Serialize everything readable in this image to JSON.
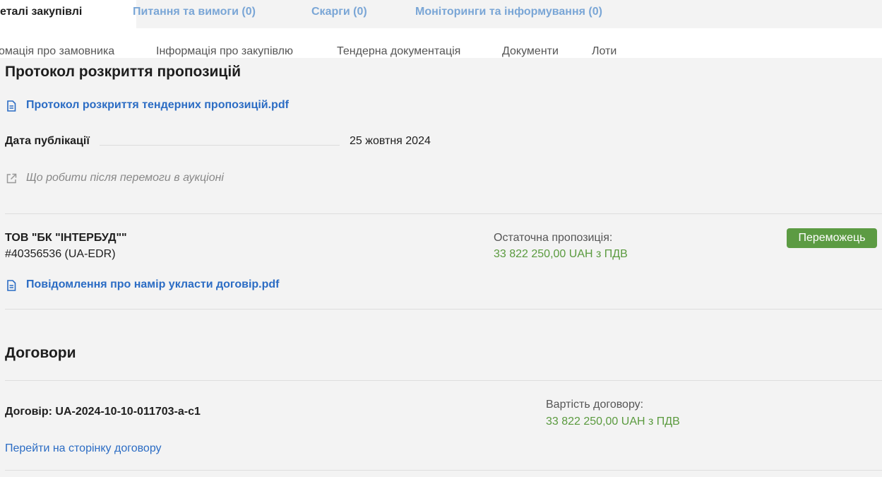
{
  "tabs": [
    {
      "label": "еталі закупівлі"
    },
    {
      "label": "Питання та вимоги (0)"
    },
    {
      "label": "Скарги (0)"
    },
    {
      "label": "Моніторинги та інформування (0)"
    }
  ],
  "subnav": [
    {
      "label": "омація про замовника"
    },
    {
      "label": "Інформація про закупівлю"
    },
    {
      "label": "Тендерна документація"
    },
    {
      "label": "Документи"
    },
    {
      "label": "Лоти"
    }
  ],
  "protocol": {
    "title": "Протокол розкриття пропозицій",
    "file_link": "Протокол розкриття тендерних пропозицій.pdf",
    "date_label": "Дата публікації",
    "date_value": "25 жовтня 2024",
    "help_link": "Що робити після перемоги в аукціоні"
  },
  "winner": {
    "name": "ТОВ \"БК \"ІНТЕРБУД\"\"",
    "edr": "#40356536 (UA-EDR)",
    "offer_label": "Остаточна пропозиція:",
    "offer_value": "33 822 250,00 UAH з ПДВ",
    "badge": "Переможець",
    "notice_link": "Повідомлення про намір укласти договір.pdf"
  },
  "contracts": {
    "title": "Договори",
    "contract_label": "Договір: UA-2024-10-10-011703-a-c1",
    "value_label": "Вартість договору:",
    "value": "33 822 250,00 UAH з ПДВ",
    "link": "Перейти на сторінку договору"
  },
  "colors": {
    "link": "#2b6cc4",
    "money_green": "#5a9a3e",
    "badge_green": "#5c9b43",
    "tab_inactive": "#7aa6d6"
  },
  "icons": {
    "document": "document-icon",
    "external_link": "external-link-icon"
  }
}
